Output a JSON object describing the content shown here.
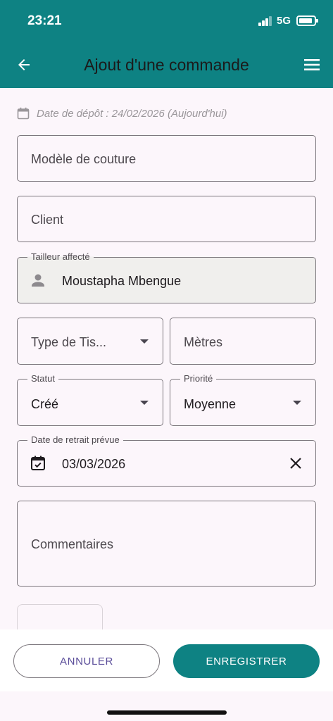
{
  "status_bar": {
    "time": "23:21",
    "network": "5G"
  },
  "app_bar": {
    "title": "Ajout d'une commande",
    "back_icon": "arrow-left-icon",
    "menu_icon": "hamburger-menu-icon"
  },
  "deposit_date": {
    "text": "Date de dépôt : 24/02/2026 (Aujourd'hui)",
    "icon": "calendar-icon"
  },
  "form": {
    "model": {
      "placeholder": "Modèle de couture"
    },
    "client": {
      "placeholder": "Client"
    },
    "tailor": {
      "label": "Tailleur affecté",
      "value": "Moustapha Mbengue",
      "icon": "person-icon"
    },
    "fabric_type": {
      "placeholder": "Type de Tis..."
    },
    "meters": {
      "placeholder": "Mètres"
    },
    "status": {
      "label": "Statut",
      "value": "Créé"
    },
    "priority": {
      "label": "Priorité",
      "value": "Moyenne"
    },
    "pickup_date": {
      "label": "Date de retrait prévue",
      "value": "03/03/2026",
      "icon": "calendar-check-icon",
      "clear_icon": "close-icon"
    },
    "comments": {
      "placeholder": "Commentaires"
    }
  },
  "actions": {
    "cancel": "ANNULER",
    "save": "ENREGISTRER"
  },
  "colors": {
    "primary": "#0e8283",
    "background": "#fcf6fb",
    "cancel_text": "#5b4e9a"
  }
}
